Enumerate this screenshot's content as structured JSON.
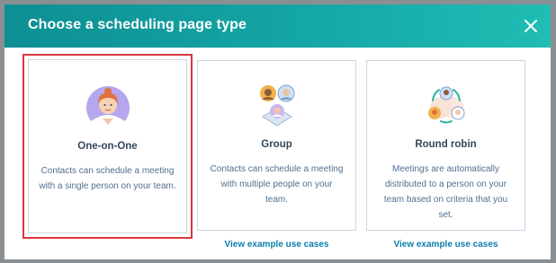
{
  "modal": {
    "title": "Choose a scheduling page type"
  },
  "cards": [
    {
      "title": "One-on-One",
      "description": "Contacts can schedule a meeting with a single person on your team.",
      "icon": "person-icon",
      "selected": true
    },
    {
      "title": "Group",
      "description": "Contacts can schedule a meeting with multiple people on your team.",
      "icon": "group-icon",
      "link": "View example use cases"
    },
    {
      "title": "Round robin",
      "description": "Meetings are automatically distributed to a person on your team based on criteria that you set.",
      "icon": "round-robin-icon",
      "link": "View example use cases"
    }
  ],
  "colors": {
    "header_start": "#0d8f93",
    "header_end": "#20bdb4",
    "selected_border": "#d9363e",
    "link": "#0b7eae"
  }
}
